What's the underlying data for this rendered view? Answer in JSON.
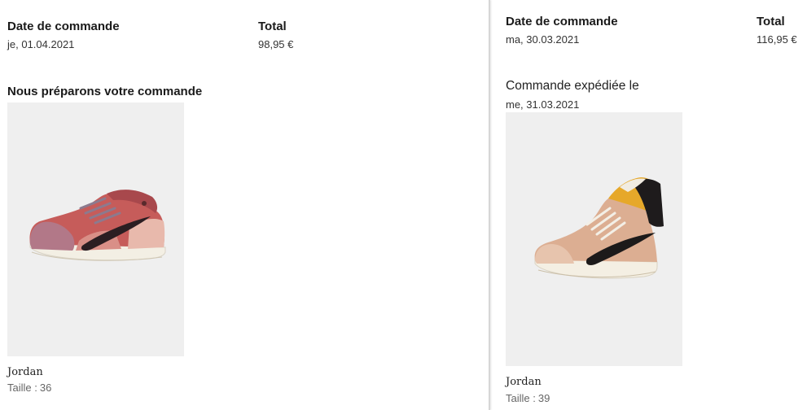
{
  "orders": [
    {
      "date_label": "Date de commande",
      "date_value": "je, 01.04.2021",
      "total_label": "Total",
      "total_value": "98,95 €",
      "status_title": "Nous préparons votre commande",
      "product": {
        "brand": "Jordan",
        "size_label": "Taille :",
        "size_value": "36",
        "image_icon": "sneaker-low-red-icon"
      }
    },
    {
      "date_label": "Date de commande",
      "date_value": "ma, 30.03.2021",
      "total_label": "Total",
      "total_value": "116,95 €",
      "status_title": "Commande expédiée le",
      "status_date": "me, 31.03.2021",
      "product": {
        "brand": "Jordan",
        "size_label": "Taille :",
        "size_value": "39",
        "image_icon": "sneaker-mid-tan-yellow-icon"
      }
    }
  ],
  "colors": {
    "card_background": "#ffffff",
    "image_background": "#efefef",
    "text_primary": "#1a1a1a",
    "text_secondary": "#666666"
  }
}
